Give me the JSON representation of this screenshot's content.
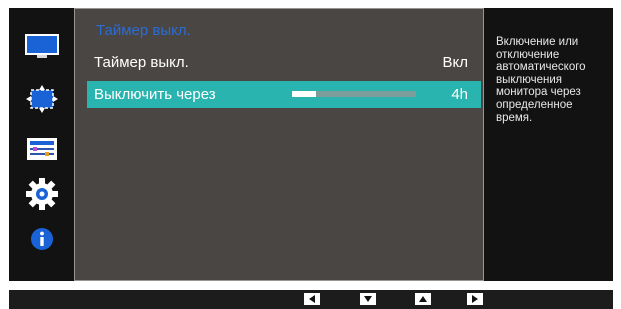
{
  "menu": {
    "title": "Таймер выкл.",
    "items": [
      {
        "label": "Таймер выкл.",
        "value": "Вкл"
      },
      {
        "label": "Выключить через",
        "value": "4h",
        "slider_fraction": 0.19
      }
    ]
  },
  "help": {
    "text": "Включение или отключение автоматического выключения монитора через определенное время."
  },
  "sidebar": {
    "icons": [
      "monitor-icon",
      "size-position-icon",
      "settings-sliders-icon",
      "gear-icon",
      "info-icon"
    ]
  },
  "nav": {
    "buttons": [
      "left-arrow",
      "down-arrow",
      "up-arrow",
      "right-arrow"
    ]
  },
  "colors": {
    "accent": "#2ab4b0",
    "title": "#2d6cd1",
    "info": "#1a63d6"
  }
}
